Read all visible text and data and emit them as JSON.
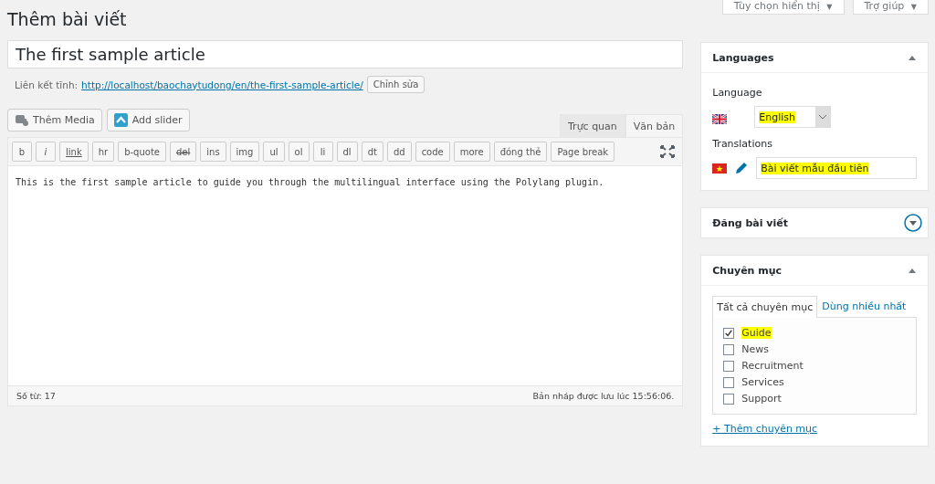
{
  "screen_options": [
    {
      "label": "Tùy chọn hiển thị",
      "caret": "▼"
    },
    {
      "label": "Trợ giúp",
      "caret": "▼"
    }
  ],
  "page_title": "Thêm bài viết",
  "post_title": {
    "value": "The first sample article"
  },
  "permalink": {
    "label": "Liên kết tĩnh:",
    "url": "http://localhost/baochaytudong/en/the-first-sample-article/",
    "edit_button": "Chỉnh sửa"
  },
  "media_buttons": [
    {
      "kind": "media",
      "label": "Thêm Media"
    },
    {
      "kind": "slider",
      "label": "Add slider"
    }
  ],
  "editor_tabs": [
    {
      "label": "Trực quan",
      "selected": false
    },
    {
      "label": "Văn bản",
      "selected": true
    }
  ],
  "quicktags": [
    {
      "label": "b",
      "kind": "bold"
    },
    {
      "label": "i",
      "kind": "italic"
    },
    {
      "label": "link",
      "kind": "underline"
    },
    {
      "label": "hr",
      "kind": "plain"
    },
    {
      "label": "b-quote",
      "kind": "plain"
    },
    {
      "label": "del",
      "kind": "strike"
    },
    {
      "label": "ins",
      "kind": "plain"
    },
    {
      "label": "img",
      "kind": "plain"
    },
    {
      "label": "ul",
      "kind": "plain"
    },
    {
      "label": "ol",
      "kind": "plain"
    },
    {
      "label": "li",
      "kind": "plain"
    },
    {
      "label": "dl",
      "kind": "plain"
    },
    {
      "label": "dt",
      "kind": "plain"
    },
    {
      "label": "dd",
      "kind": "plain"
    },
    {
      "label": "code",
      "kind": "plain"
    },
    {
      "label": "more",
      "kind": "plain"
    },
    {
      "label": "đóng thẻ",
      "kind": "plain"
    },
    {
      "label": "Page break",
      "kind": "plain"
    }
  ],
  "content": "This is the first sample article to guide you through the multilingual interface using the Polylang plugin.",
  "status_bar": {
    "word_count": "Số từ: 17",
    "autosave": "Bản nháp được lưu lúc 15:56:06."
  },
  "languages_box": {
    "title": "Languages",
    "expanded": true,
    "language_label": "Language",
    "language": {
      "value": "English",
      "highlighted": true
    },
    "translations_label": "Translations",
    "translation": {
      "value": "Bài viết mẫu đầu tiên",
      "highlighted": true
    }
  },
  "publish_box": {
    "title": "Đăng bài viết",
    "expanded": false
  },
  "categories_box": {
    "title": "Chuyên mục",
    "expanded": true,
    "tabs": [
      {
        "label": "Tất cả chuyên mục",
        "selected": true
      },
      {
        "label": "Dùng nhiều nhất",
        "selected": false
      }
    ],
    "items": [
      {
        "label": "Guide",
        "checked": true,
        "highlighted": true
      },
      {
        "label": "News",
        "checked": false,
        "highlighted": false
      },
      {
        "label": "Recruitment",
        "checked": false,
        "highlighted": false
      },
      {
        "label": "Services",
        "checked": false,
        "highlighted": false
      },
      {
        "label": "Support",
        "checked": false,
        "highlighted": false
      }
    ],
    "add_link": "+ Thêm chuyên mục"
  }
}
